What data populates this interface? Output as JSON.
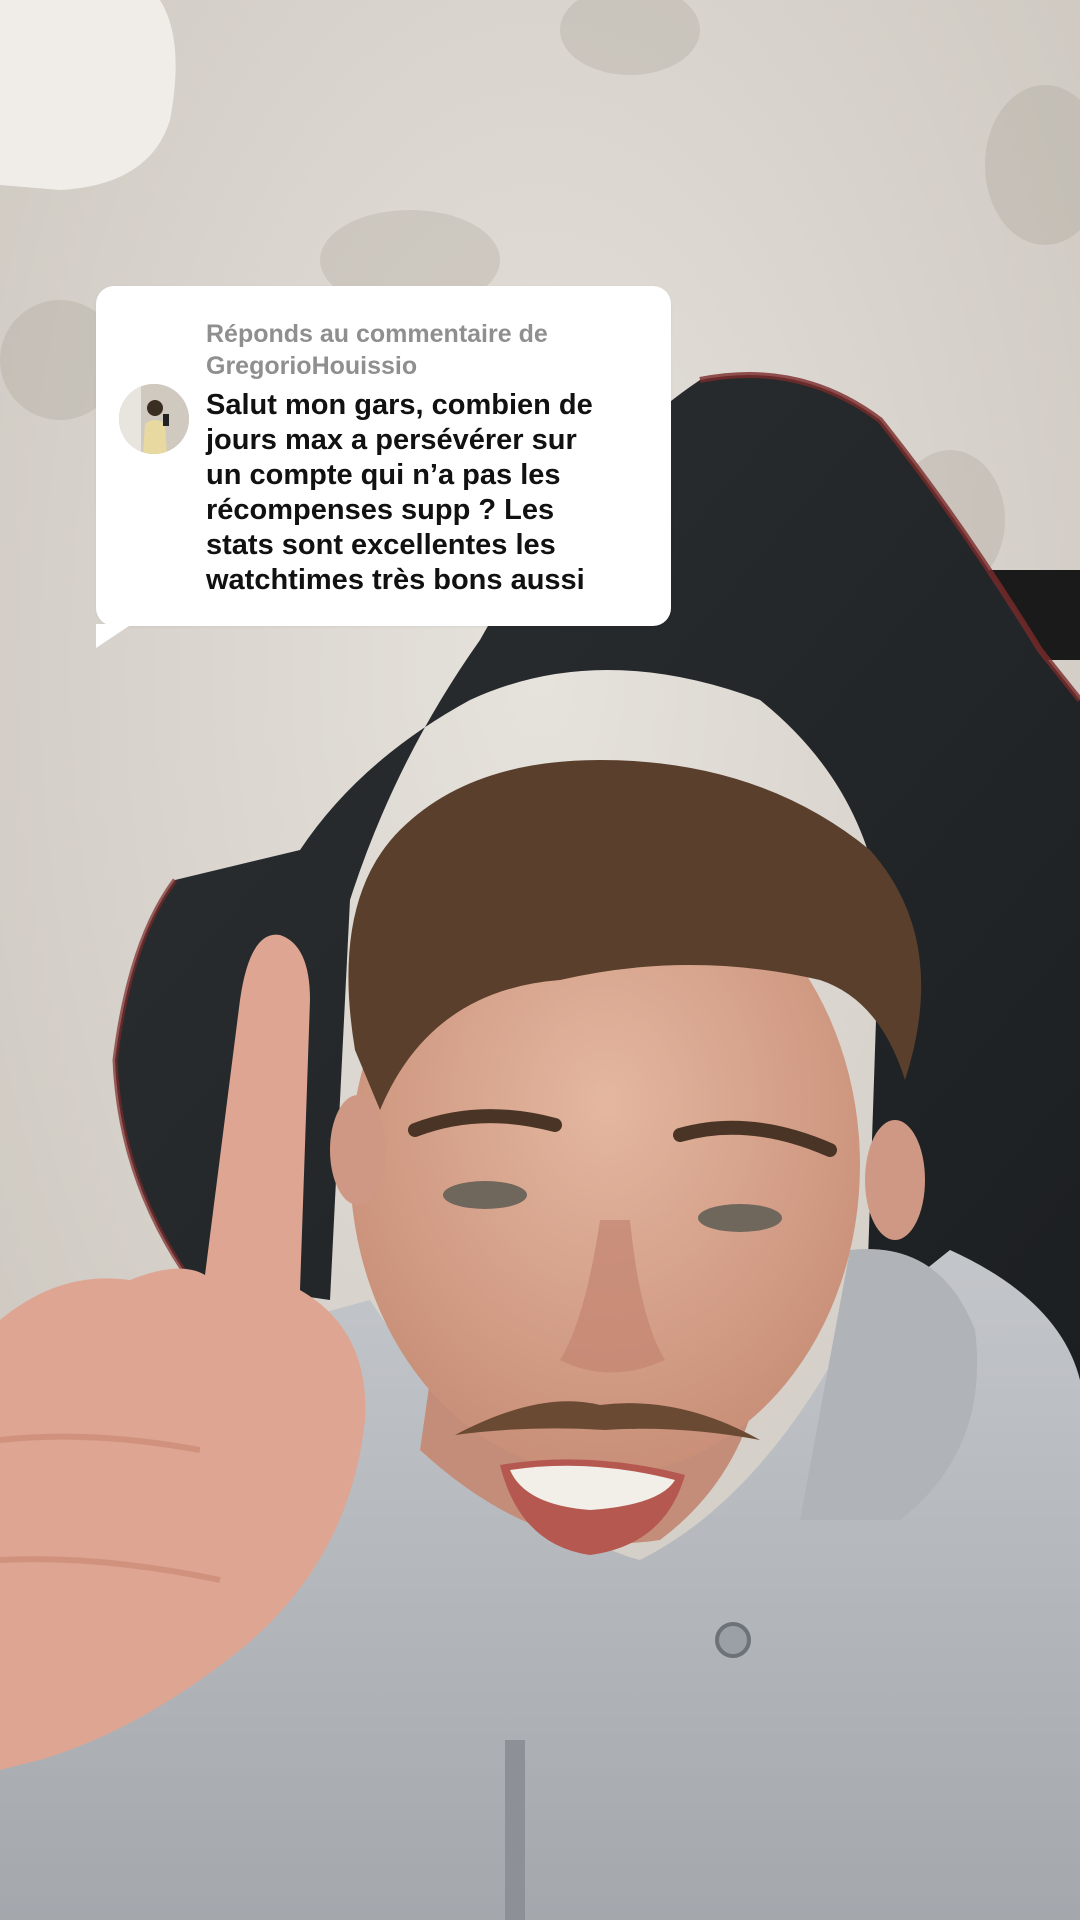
{
  "comment_reply": {
    "header_prefix": "Réponds au commentaire de",
    "username": "GregorioHouissio",
    "comment_lines": [
      "Salut mon gars, combien de",
      "jours max a persévérer sur",
      "un compte qui n’a pas les",
      "récompenses supp ? Les",
      "stats sont excellentes les",
      "watchtimes très bons aussi"
    ]
  },
  "colors": {
    "sticker_background": "#ffffff",
    "header_text": "#8f8f8f",
    "comment_text": "#111111",
    "chair_accent": "#7a2a2a",
    "hoodie": "#b9bcc0"
  },
  "icons": {
    "avatar": "commenter-avatar",
    "video": "creator-video-frame"
  }
}
